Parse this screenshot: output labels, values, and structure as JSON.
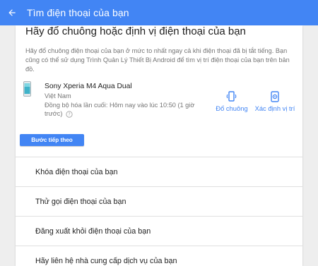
{
  "header": {
    "title": "Tìm điện thoại của bạn",
    "bg_color": "#4285f4"
  },
  "card": {
    "heading": "Hãy đổ chuông hoặc định vị điện thoại của bạn",
    "description": "Hãy đổ chuông điện thoại của bạn ở mức to nhất ngay cả khi điện thoại đã bị tắt tiếng. Bạn cũng có thể sử dụng Trình Quản Lý Thiết Bị Android để tìm vị trí điện thoại của bạn trên bản đồ.",
    "device": {
      "name": "Sony Xperia M4 Aqua Dual",
      "country": "Việt Nam",
      "last_sync": "Đồng bộ hóa lần cuối: Hôm nay vào lúc 10:50 (1 giờ trước)"
    },
    "actions": {
      "ring_label": "Đổ chuông",
      "locate_label": "Xác định vị trí"
    },
    "next_button": "Bước tiếp theo"
  },
  "options": [
    {
      "label": "Khóa điện thoại của bạn"
    },
    {
      "label": "Thử gọi điện thoại của bạn"
    },
    {
      "label": "Đăng xuất khỏi điện thoại của bạn"
    },
    {
      "label": "Hãy liên hệ nhà cung cấp dịch vụ của bạn"
    }
  ],
  "colors": {
    "accent": "#4285f4",
    "background": "#eeeeee"
  }
}
